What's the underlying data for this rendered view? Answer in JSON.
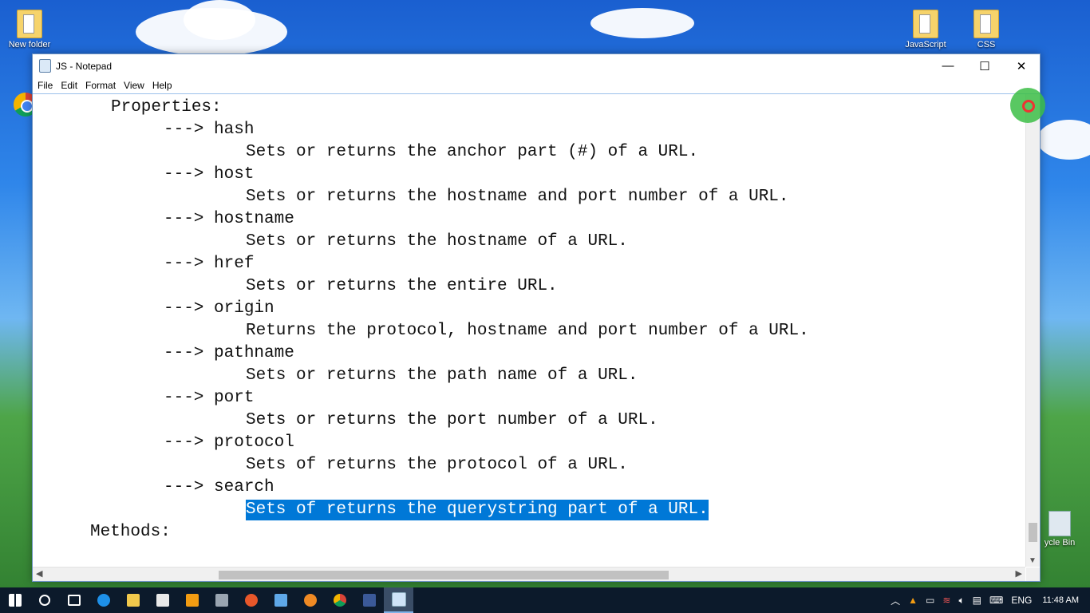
{
  "window": {
    "title": "JS - Notepad",
    "controls": {
      "minimize": "—",
      "maximize": "☐",
      "close": "✕"
    }
  },
  "menu": {
    "file": "File",
    "edit": "Edit",
    "format": "Format",
    "view": "View",
    "help": "Help"
  },
  "editor": {
    "lines": [
      "Properties:",
      "---> hash",
      "Sets or returns the anchor part (#) of a URL.",
      "---> host",
      "Sets or returns the hostname and port number of a URL.",
      "---> hostname",
      "Sets or returns the hostname of a URL.",
      "---> href",
      "Sets or returns the entire URL.",
      "---> origin",
      "Returns the protocol, hostname and port number of a URL.",
      "---> pathname",
      "Sets or returns the path name of a URL.",
      "---> port",
      "Sets or returns the port number of a URL.",
      "---> protocol",
      "Sets of returns the protocol of a URL.",
      "---> search",
      "Sets of returns the querystring part of a URL.",
      "Methods:"
    ],
    "selected_line_index": 18
  },
  "desktop": {
    "icons": [
      {
        "label": "New folder",
        "icon": "folder-icon"
      },
      {
        "label": "JavaScript",
        "icon": "folder-icon"
      },
      {
        "label": "CSS",
        "icon": "folder-icon"
      },
      {
        "label": "ycle Bin",
        "icon": "recycle-bin-icon"
      }
    ]
  },
  "taskbar": {
    "apps": [
      "windows-start-icon",
      "search-icon",
      "task-view-icon",
      "edge-icon",
      "file-explorer-icon",
      "store-icon",
      "media-player-icon",
      "film-icon",
      "firefox-icon",
      "window-icon",
      "paint-icon",
      "chrome-icon",
      "facebook-icon",
      "notepad-icon"
    ],
    "tray": {
      "language": "ENG",
      "time": "11:48 AM"
    }
  },
  "colors": {
    "selection": "#0078d7",
    "taskbar": "#0c1a2b"
  }
}
